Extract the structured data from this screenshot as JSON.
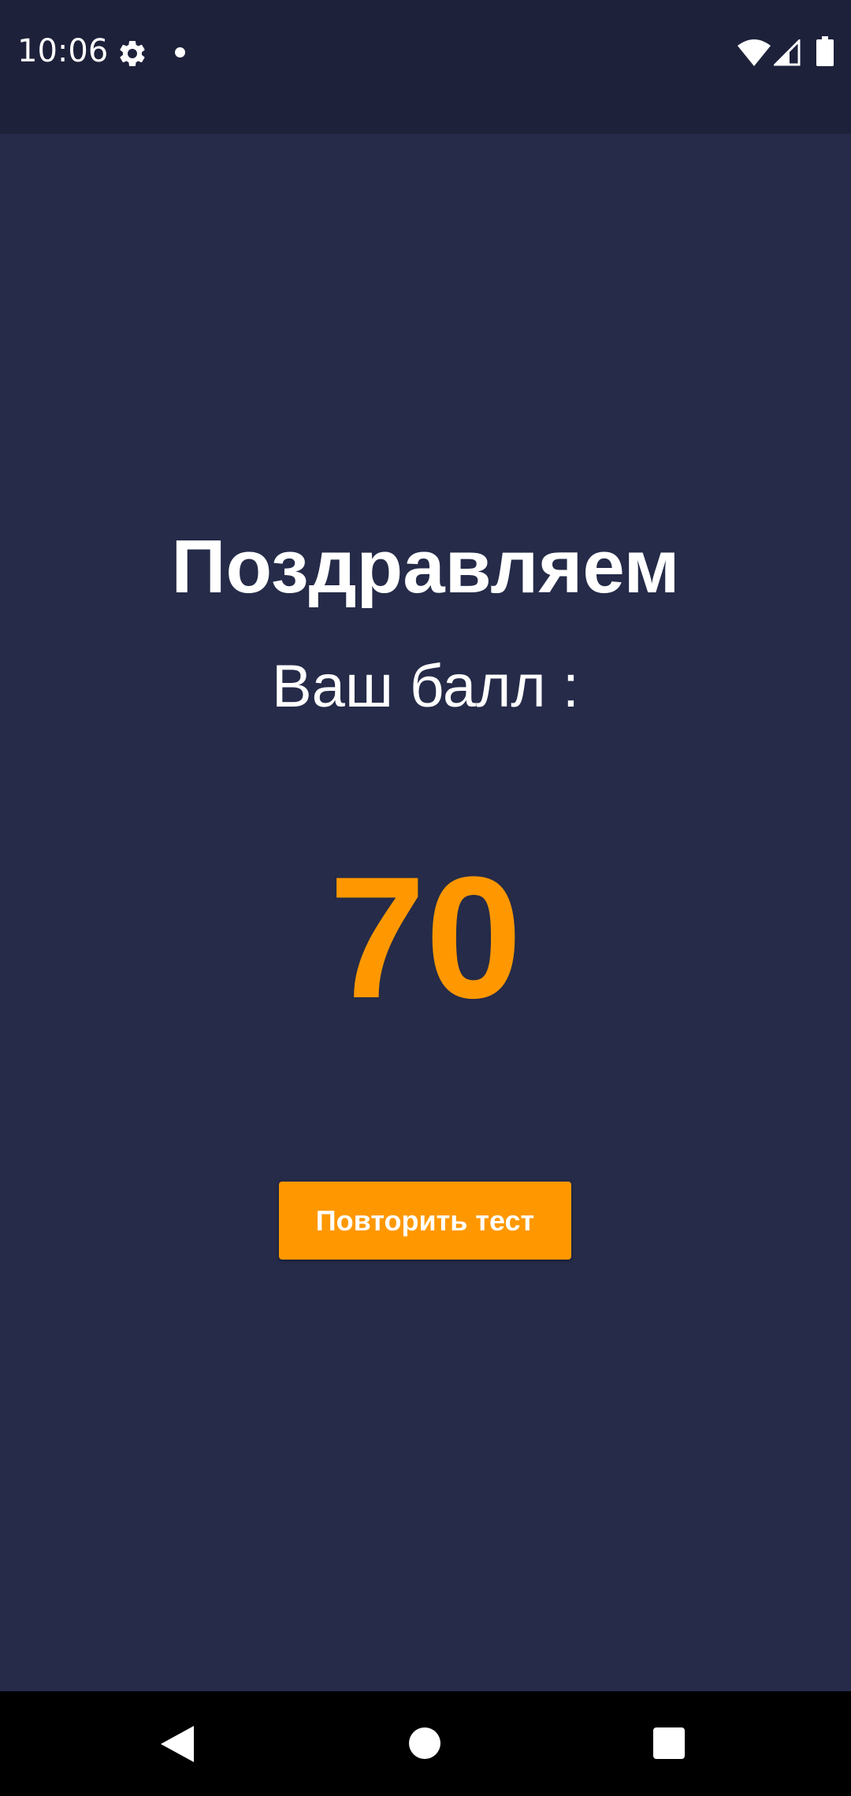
{
  "status_bar": {
    "time": "10:06",
    "icons": [
      "settings-gear-icon",
      "notification-dot-icon",
      "wifi-icon",
      "cellular-signal-icon",
      "battery-icon"
    ]
  },
  "result": {
    "title": "Поздравляем",
    "subtitle": "Ваш балл :",
    "score": "70"
  },
  "actions": {
    "retry_label": "Повторить тест"
  },
  "navigation": {
    "icons": [
      "back-icon",
      "home-icon",
      "recent-apps-icon"
    ]
  },
  "colors": {
    "background": "#252b48",
    "status_bar": "#1e213a",
    "accent": "#ff9800",
    "text": "#ffffff",
    "nav_bar": "#000000"
  }
}
